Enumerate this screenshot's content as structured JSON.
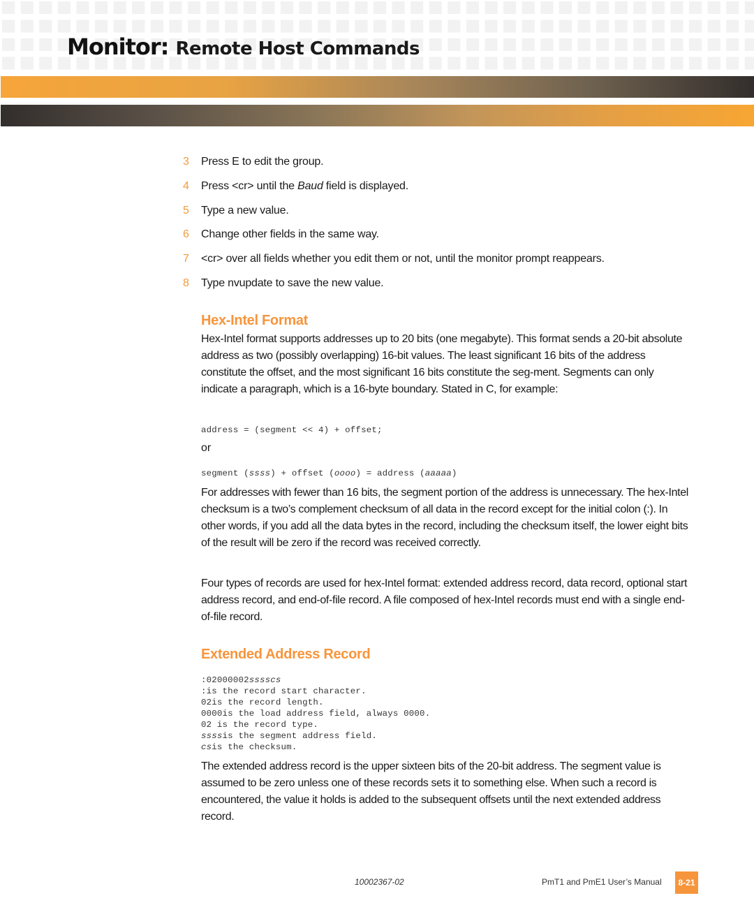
{
  "header": {
    "title_bold": "Monitor:",
    "title_light": "Remote Host Commands"
  },
  "steps": [
    {
      "num": "3",
      "text_parts": [
        "Press E to edit the group."
      ]
    },
    {
      "num": "4",
      "before": "Press <cr> until the ",
      "italic": "Baud",
      "after": " field is displayed."
    },
    {
      "num": "5",
      "text": "Type a new value."
    },
    {
      "num": "6",
      "text": "Change other fields in the same way."
    },
    {
      "num": "7",
      "text": "<cr> over all fields whether you edit them or not, until the monitor prompt reappears."
    },
    {
      "num": "8",
      "text": "Type nvupdate to save the new value."
    }
  ],
  "step3_text": "Press E to edit the group.",
  "hex_intel": {
    "heading": "Hex-Intel Format",
    "intro": "Hex-Intel format supports addresses up to 20 bits (one megabyte). This format sends a 20-bit absolute address as two (possibly overlapping) 16-bit values. The least significant 16 bits of the address constitute the offset, and the most significant 16 bits constitute the seg-ment. Segments can only indicate a paragraph, which is a 16-byte boundary. Stated in C, for example:",
    "code1": "address = (segment << 4) + offset;",
    "or": "or",
    "code2": {
      "p1": "segment (",
      "i1": "ssss",
      "p2": ") + offset (",
      "i2": "oooo",
      "p3": ") = address (",
      "i3": "aaaaa",
      "p4": ")"
    },
    "para2": "For addresses with fewer than 16 bits, the segment portion of the address is unnecessary. The hex-Intel checksum is a two’s complement checksum of all data in the record except for the initial colon (:). In other words, if you add all the data bytes in the record, including the checksum itself, the lower eight bits of the result will be zero if the record was received correctly.",
    "para3": "Four types of records are used for hex-Intel format:  extended address record, data record, optional start address record, and end-of-file record. A file composed of hex-Intel records must end with a single end-of-file record."
  },
  "extended": {
    "heading": "Extended Address Record",
    "code_lines": [
      {
        "plain": ":02000002",
        "italic": "sssscs",
        "rest": ""
      },
      {
        "plain": ":is the record start character.",
        "italic": "",
        "rest": ""
      },
      {
        "plain": "02is the record length.",
        "italic": "",
        "rest": ""
      },
      {
        "plain": "0000is the load address field, always 0000.",
        "italic": "",
        "rest": ""
      },
      {
        "plain": "02 is the record type.",
        "italic": "",
        "rest": ""
      },
      {
        "plain": "",
        "italic": "ssss",
        "rest": "is the segment address field."
      },
      {
        "plain": "",
        "italic": "cs",
        "rest": "is the checksum."
      }
    ],
    "para": "The extended address record is the upper sixteen bits of the 20-bit address. The segment value is assumed to be zero unless one of these records sets it to something else. When such a record is encountered, the value it holds is added to the subsequent offsets until the next extended address record."
  },
  "footer": {
    "doc_number": "10002367-02",
    "manual_title": "PmT1 and PmE1 User’s Manual",
    "page_number": "8-21"
  },
  "colors": {
    "accent_orange": "#f7953c",
    "band_dark": "#322e2c"
  }
}
